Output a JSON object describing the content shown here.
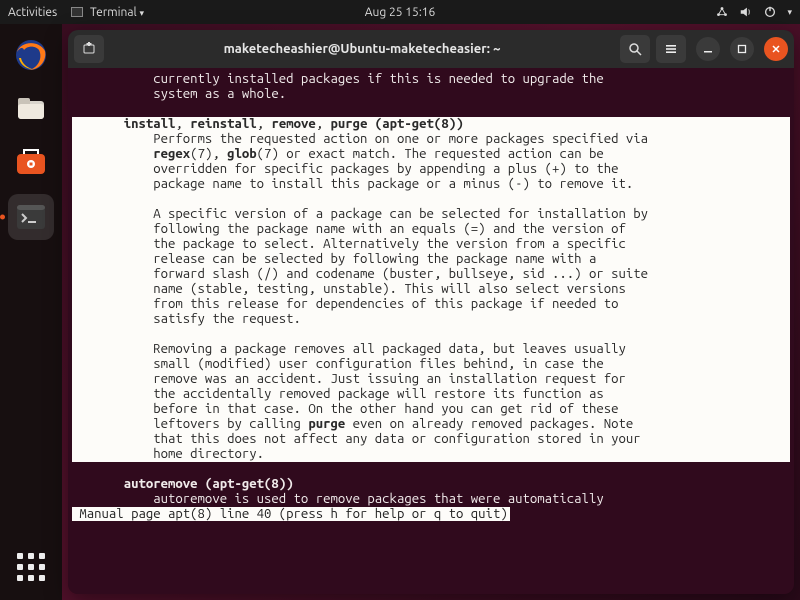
{
  "topbar": {
    "activities": "Activities",
    "app_menu": "Terminal",
    "clock": "Aug 25  15:16"
  },
  "dock": {
    "items": [
      {
        "name": "firefox"
      },
      {
        "name": "files"
      },
      {
        "name": "software"
      },
      {
        "name": "terminal",
        "active": true
      }
    ]
  },
  "window": {
    "title": "maketecheashier@Ubuntu-maketecheasier: ~"
  },
  "man": {
    "intro1": "           currently installed packages if this is needed to upgrade the",
    "intro2": "           system as a whole.",
    "cmd_heading_pre": "       ",
    "cmd_install": "install",
    "cmd_sep1": ", ",
    "cmd_reinstall": "reinstall",
    "cmd_sep2": ", ",
    "cmd_remove": "remove",
    "cmd_sep3": ", ",
    "cmd_purge": "purge",
    "cmd_tail": " (apt-get(8))",
    "p1a": "           Performs the requested action on one or more packages specified via",
    "p1b_pre": "           ",
    "p1b_regex": "regex",
    "p1b_mid1": "(7), ",
    "p1b_glob": "glob",
    "p1b_mid2": "(7) or exact match. The requested action can be",
    "p1c": "           overridden for specific packages by appending a plus (+) to the",
    "p1d": "           package name to install this package or a minus (-) to remove it.",
    "p2a": "           A specific version of a package can be selected for installation by",
    "p2b": "           following the package name with an equals (=) and the version of",
    "p2c": "           the package to select. Alternatively the version from a specific",
    "p2d": "           release can be selected by following the package name with a",
    "p2e": "           forward slash (/) and codename (buster, bullseye, sid ...) or suite",
    "p2f": "           name (stable, testing, unstable). This will also select versions",
    "p2g": "           from this release for dependencies of this package if needed to",
    "p2h": "           satisfy the request.",
    "p3a": "           Removing a package removes all packaged data, but leaves usually",
    "p3b": "           small (modified) user configuration files behind, in case the",
    "p3c": "           remove was an accident. Just issuing an installation request for",
    "p3d": "           the accidentally removed package will restore its function as",
    "p3e": "           before in that case. On the other hand you can get rid of these",
    "p3f_pre": "           leftovers by calling ",
    "p3f_purge": "purge",
    "p3f_post": " even on already removed packages. Note",
    "p3g": "           that this does not affect any data or configuration stored in your",
    "p3h": "           home directory.",
    "auto_head_pre": "       ",
    "auto_head": "autoremove (apt-get(8))",
    "auto1": "           autoremove is used to remove packages that were automatically",
    "status": " Manual page apt(8) line 40 (press h for help or q to quit)"
  }
}
